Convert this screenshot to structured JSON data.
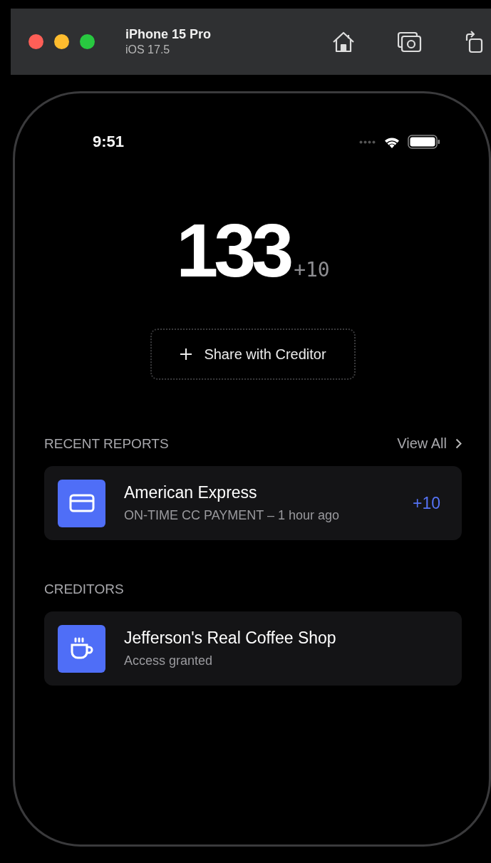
{
  "simulator": {
    "device_name": "iPhone 15 Pro",
    "os_version": "iOS 17.5"
  },
  "status_bar": {
    "time": "9:51"
  },
  "score": {
    "value": "133",
    "change": "+10"
  },
  "share_button": {
    "label": "Share with Creditor"
  },
  "recent_reports": {
    "heading": "RECENT REPORTS",
    "link": "View All",
    "items": [
      {
        "kind": "credit-card",
        "title": "American Express",
        "subtitle": "ON-TIME CC PAYMENT – 1 hour ago",
        "points": "+10"
      }
    ]
  },
  "creditors": {
    "heading": "CREDITORS",
    "items": [
      {
        "kind": "coffee",
        "title": "Jefferson's Real Coffee Shop",
        "subtitle": "Access granted"
      }
    ]
  }
}
